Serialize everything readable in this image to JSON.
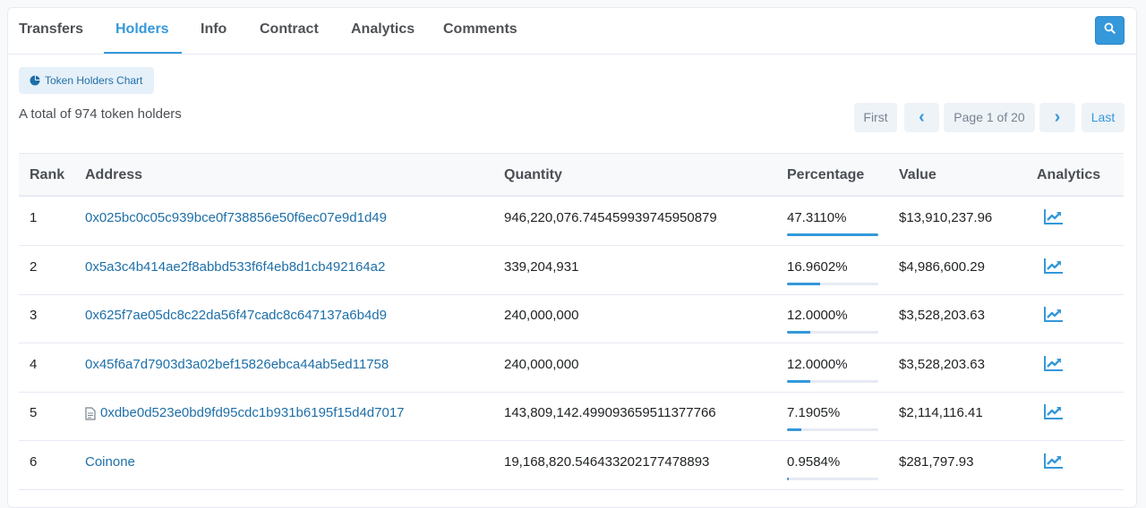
{
  "tabs": [
    {
      "label": "Transfers"
    },
    {
      "label": "Holders",
      "active": true
    },
    {
      "label": "Info"
    },
    {
      "label": "Contract"
    },
    {
      "label": "Analytics"
    },
    {
      "label": "Comments"
    }
  ],
  "chart_button": {
    "label": "Token Holders Chart",
    "icon": "pie-chart-icon"
  },
  "summary": "A total of 974 token holders",
  "pagination": {
    "first": "First",
    "prev": "‹",
    "page": "Page 1 of 20",
    "next": "›",
    "last": "Last"
  },
  "table": {
    "headers": {
      "rank": "Rank",
      "address": "Address",
      "quantity": "Quantity",
      "percentage": "Percentage",
      "value": "Value",
      "analytics": "Analytics"
    },
    "rows": [
      {
        "rank": "1",
        "address": "0x025bc0c05c939bce0f738856e50f6ec07e9d1d49",
        "is_contract": false,
        "quantity": "946,220,076.745459939745950879",
        "percentage": "47.3110%",
        "pct_value": 47.311,
        "value": "$13,910,237.96"
      },
      {
        "rank": "2",
        "address": "0x5a3c4b414ae2f8abbd533f6f4eb8d1cb492164a2",
        "is_contract": false,
        "quantity": "339,204,931",
        "percentage": "16.9602%",
        "pct_value": 16.9602,
        "value": "$4,986,600.29"
      },
      {
        "rank": "3",
        "address": "0x625f7ae05dc8c22da56f47cadc8c647137a6b4d9",
        "is_contract": false,
        "quantity": "240,000,000",
        "percentage": "12.0000%",
        "pct_value": 12.0,
        "value": "$3,528,203.63"
      },
      {
        "rank": "4",
        "address": "0x45f6a7d7903d3a02bef15826ebca44ab5ed11758",
        "is_contract": false,
        "quantity": "240,000,000",
        "percentage": "12.0000%",
        "pct_value": 12.0,
        "value": "$3,528,203.63"
      },
      {
        "rank": "5",
        "address": "0xdbe0d523e0bd9fd95cdc1b931b6195f15d4d7017",
        "is_contract": true,
        "quantity": "143,809,142.499093659511377766",
        "percentage": "7.1905%",
        "pct_value": 7.1905,
        "value": "$2,114,116.41"
      },
      {
        "rank": "6",
        "address": "Coinone",
        "is_contract": false,
        "quantity": "19,168,820.546433202177478893",
        "percentage": "0.9584%",
        "pct_value": 0.9584,
        "value": "$281,797.93"
      }
    ]
  },
  "colors": {
    "accent": "#3498db",
    "link": "#1e6fa8"
  }
}
